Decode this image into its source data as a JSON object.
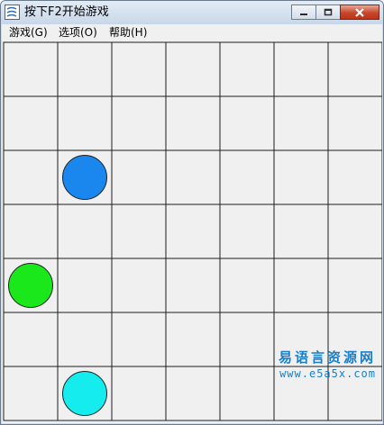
{
  "window": {
    "title": "按下F2开始游戏"
  },
  "menu": [
    {
      "label": "游戏(G)"
    },
    {
      "label": "选项(O)"
    },
    {
      "label": "帮助(H)"
    }
  ],
  "board": {
    "cols": 7,
    "rows": 7,
    "pieces": [
      {
        "col": 1,
        "row": 2,
        "color": "#1a87ef"
      },
      {
        "col": 0,
        "row": 4,
        "color": "#1ae81a"
      },
      {
        "col": 1,
        "row": 6,
        "color": "#15ecee"
      }
    ]
  },
  "watermark": {
    "title": "易语言资源网",
    "url": "www.e5a5x.com"
  }
}
